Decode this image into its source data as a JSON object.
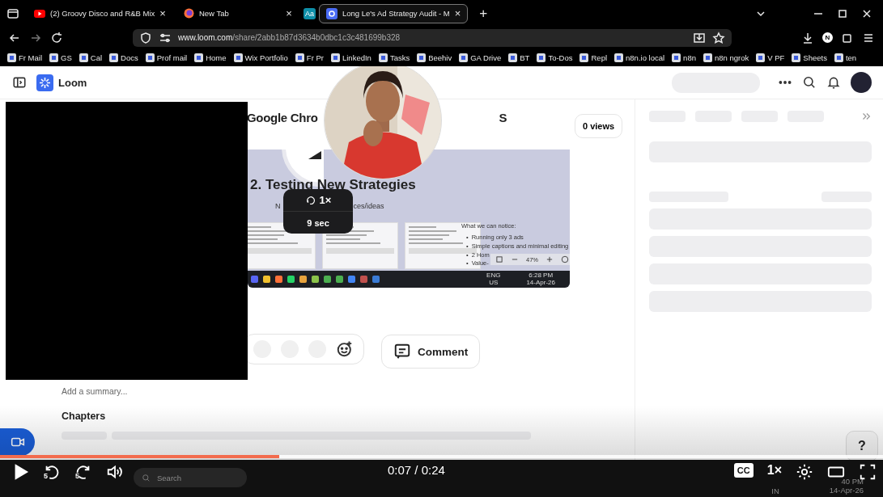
{
  "browser": {
    "tabs": [
      {
        "title": "(2) Groovy Disco and R&B Mix",
        "selected": false,
        "close": "×"
      },
      {
        "title": "New Tab",
        "selected": false,
        "close": "×"
      },
      {
        "title": "Long Le's Ad Strategy Audit - M",
        "selected": true,
        "close": "×"
      }
    ],
    "extension_badge": "Aa",
    "new_tab": "+",
    "url_domain": "www.loom.com",
    "url_path": "/share/2abb1b87d3634b0dbc1c3c481699b328",
    "bookmarks": [
      "Fr Mail",
      "GS",
      "Cal",
      "Docs",
      "Prof mail",
      "Home",
      "Wix Portfolio",
      "Fr Pr",
      "LinkedIn",
      "Tasks",
      "Beehiv",
      "GA Drive",
      "BT",
      "To-Dos",
      "Repl",
      "n8n.io local",
      "n8n",
      "n8n ngrok",
      "V PF",
      "Sheets",
      "ten"
    ],
    "profile_initial": "N"
  },
  "loom": {
    "brand": "Loom",
    "title_parts": [
      "Google Chro",
      "S"
    ],
    "views": "0 views",
    "slide": {
      "heading": "2. Testing New Strategies",
      "subtitle_parts": [
        "N",
        "ces/ideas"
      ],
      "notice_title": "What we can notice:",
      "bullets": [
        "Running only 3 ads",
        "Simple captions and minimal editing",
        "2 Hom",
        "Value-"
      ],
      "bullet_mark": "•",
      "zoom": "47%",
      "taskbar_lang": "ENG",
      "taskbar_region": "US",
      "taskbar_time": "6:28 PM",
      "taskbar_date": "14-Apr-26"
    },
    "speed_badge": {
      "speed": "1×",
      "duration": "9 sec"
    },
    "comment": "Comment",
    "summary_placeholder": "Add a summary...",
    "chapters": "Chapters",
    "help": "?"
  },
  "taskbar": {
    "search": "Search",
    "region": "IN",
    "time": "40 PM",
    "date": "14-Apr-26"
  },
  "player": {
    "progress": {
      "level": 0.316
    },
    "rewind": "5",
    "forward": "5",
    "time": "0:07 / 0:24",
    "cc": "CC",
    "speed": "1×"
  }
}
